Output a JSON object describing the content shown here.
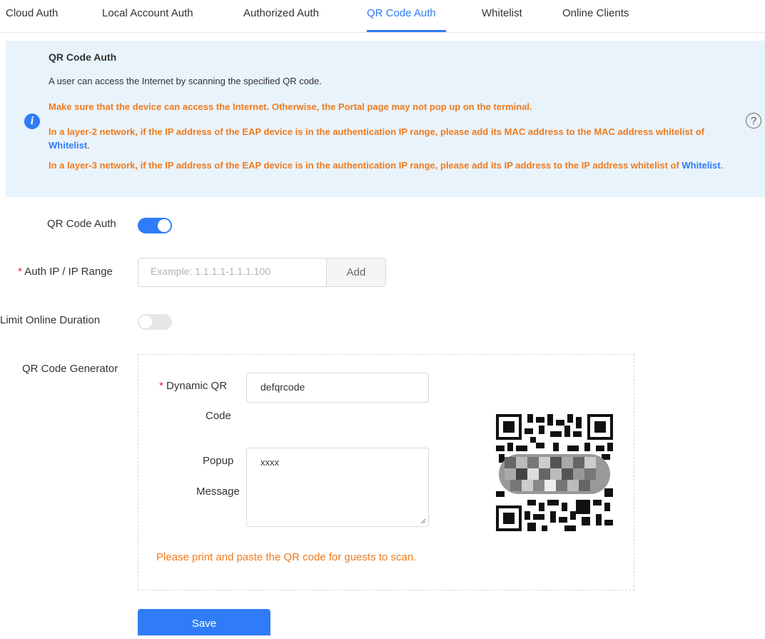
{
  "tabs": [
    {
      "label": "Cloud Auth"
    },
    {
      "label": "Local Account Auth"
    },
    {
      "label": "Authorized Auth"
    },
    {
      "label": "QR Code Auth",
      "active": true
    },
    {
      "label": "Whitelist"
    },
    {
      "label": "Online Clients"
    }
  ],
  "info": {
    "title": "QR Code Auth",
    "description": "A user can access the Internet by scanning the specified QR code.",
    "warning1": "Make sure that the device can access the Internet. Otherwise, the Portal page may not pop up on the terminal.",
    "warning2_pre": "In a layer-2 network, if the IP address of the EAP device is in the authentication IP range, please add its MAC address to the MAC address whitelist of ",
    "warning2_link": "Whitelist",
    "warning2_post": ".",
    "warning3_pre": "In a layer-3 network, if the IP address of the EAP device is in the authentication IP range, please add its IP address to the IP address whitelist of ",
    "warning3_link": "Whitelist",
    "warning3_post": "."
  },
  "form": {
    "qr_auth_label": "QR Code Auth",
    "qr_auth_enabled": true,
    "auth_ip_label": "Auth IP / IP Range",
    "auth_ip_placeholder": "Example: 1.1.1.1-1.1.1.100",
    "add_label": "Add",
    "limit_label": "Limit Online Duration",
    "limit_enabled": false,
    "generator_label": "QR Code Generator",
    "dynamic_label_1": "Dynamic QR",
    "dynamic_label_2": "Code",
    "dynamic_value": "defqrcode",
    "popup_label_1": "Popup",
    "popup_label_2": "Message",
    "popup_value": "xxxx",
    "note": "Please print and paste the QR code for guests to scan.",
    "save_label": "Save"
  },
  "colors": {
    "accent": "#2f7cf6",
    "warning": "#f07b1e",
    "info_bg": "#e9f3fb",
    "required": "#f5222d"
  }
}
